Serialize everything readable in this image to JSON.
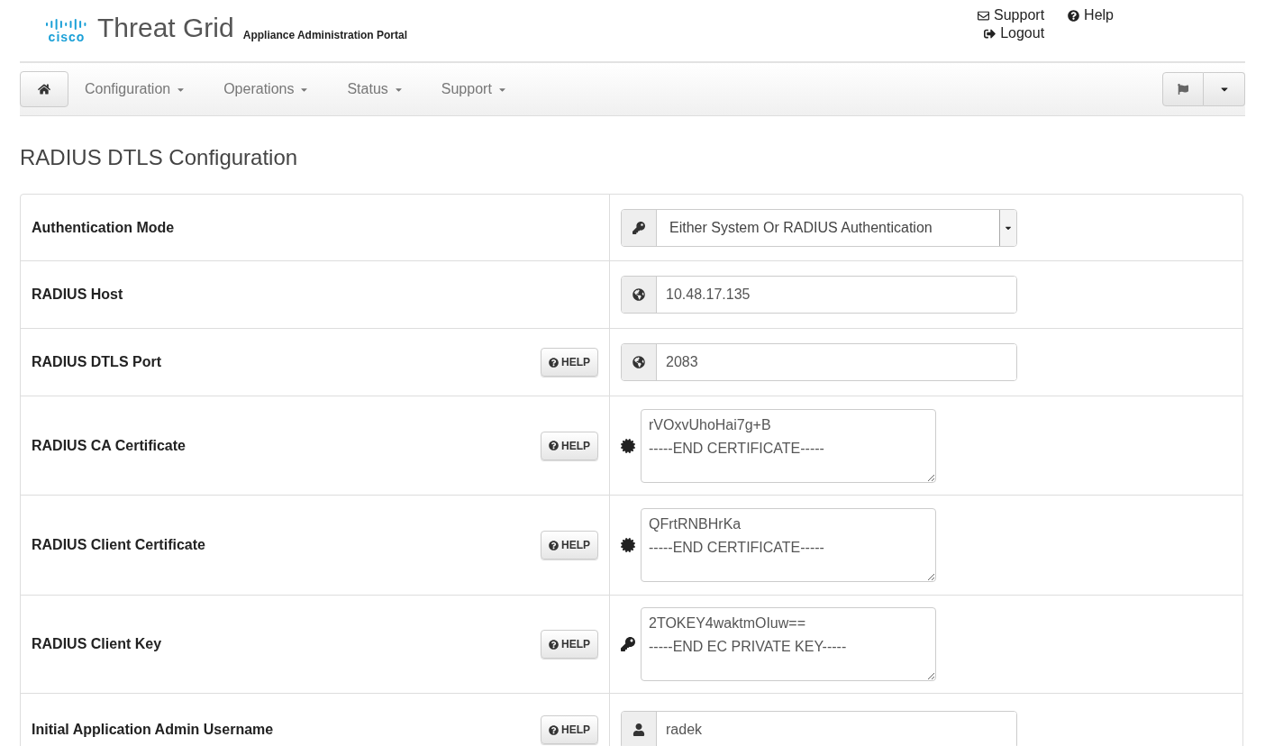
{
  "header": {
    "logo_text": "cisco",
    "product": "Threat Grid",
    "subtitle": "Appliance Administration Portal",
    "links": [
      {
        "label": "Support"
      },
      {
        "label": "Help"
      },
      {
        "label": "Logout"
      }
    ]
  },
  "nav": {
    "items": [
      {
        "label": "Configuration"
      },
      {
        "label": "Operations"
      },
      {
        "label": "Status"
      },
      {
        "label": "Support"
      }
    ]
  },
  "page_title": "RADIUS DTLS Configuration",
  "rows": [
    {
      "label": "Authentication Mode",
      "kind": "select",
      "value": "Either System Or RADIUS Authentication"
    },
    {
      "label": "RADIUS Host",
      "kind": "input",
      "value": "10.48.17.135"
    },
    {
      "label": "RADIUS DTLS Port",
      "kind": "input",
      "value": "2083",
      "help": "HELP"
    },
    {
      "label": "RADIUS CA Certificate",
      "kind": "textarea",
      "value": "rVOxvUhoHai7g+B\n-----END CERTIFICATE-----",
      "help": "HELP"
    },
    {
      "label": "RADIUS Client Certificate",
      "kind": "textarea",
      "value": "QFrtRNBHrKa\n-----END CERTIFICATE-----",
      "help": "HELP"
    },
    {
      "label": "RADIUS Client Key",
      "kind": "textarea",
      "value": "2TOKEY4waktmOIuw==\n-----END EC PRIVATE KEY-----",
      "help": "HELP"
    },
    {
      "label": "Initial Application Admin Username",
      "kind": "input",
      "value": "radek",
      "help": "HELP"
    }
  ]
}
